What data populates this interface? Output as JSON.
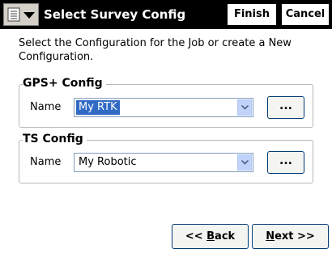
{
  "titlebar": {
    "title": "Select Survey Config",
    "finish_label": "Finish",
    "cancel_label": "Cancel",
    "menu_icon": "start-menu-icon"
  },
  "instructions": "Select the Configuration for the Job or create a New Configuration.",
  "gps_group": {
    "title": "GPS+ Config",
    "name_label": "Name",
    "selected_value": "My RTK",
    "browse_label": "..."
  },
  "ts_group": {
    "title": "TS Config",
    "name_label": "Name",
    "selected_value": "My Robotic",
    "browse_label": "..."
  },
  "nav": {
    "back_prefix": "<< ",
    "back_mnemonic": "B",
    "back_rest": "ack",
    "next_mnemonic": "N",
    "next_rest": "ext >>"
  },
  "colors": {
    "titlebar_bg": "#000000",
    "selection": "#316ac5",
    "dropdown_arrow_bg": "#c1d3fb"
  }
}
